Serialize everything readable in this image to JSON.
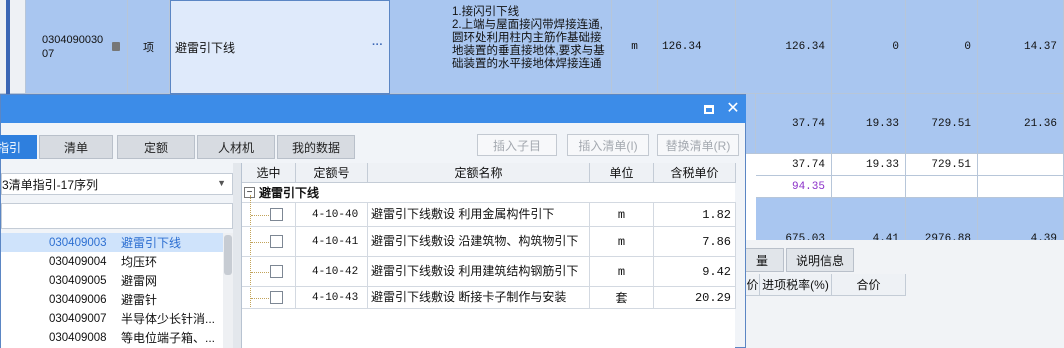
{
  "background": {
    "top_row": {
      "code": "0304090030\n07",
      "unit_type": "项",
      "name": "避雷引下线",
      "more": "···",
      "feature": "1.接闪引下线\n2.上端与屋面接闪带焊接连通,圆环处利用柱内主筋作基础接地装置的垂直接地体,要求与基础装置的水平接地体焊接连通",
      "unit": "m",
      "qty1": "126.34",
      "qty2": "126.34",
      "v3": "0",
      "v4": "0",
      "v5": "14.37"
    },
    "row2": [
      "37.74",
      "19.33",
      "729.51",
      "21.36"
    ],
    "row3": [
      "37.74",
      "19.33",
      "729.51"
    ],
    "row4": [
      "94.35"
    ],
    "row5": [
      "675.03",
      "4.41",
      "2976.88",
      "4.39"
    ]
  },
  "bottom_pane": {
    "tab_partial": "量",
    "tab_info": "说明信息",
    "headers": [
      "价",
      "进项税率(%)",
      "合价"
    ]
  },
  "dialog": {
    "tabs": [
      "指引",
      "清单",
      "定额",
      "人材机",
      "我的数据"
    ],
    "buttons": {
      "insert_child": "插入子目",
      "insert_list": "插入清单(I)",
      "replace_list": "替换清单(R)"
    },
    "library": "3清单指引-17序列",
    "search_value": "",
    "tree_items": [
      {
        "code": "030409003",
        "name": "避雷引下线"
      },
      {
        "code": "030409004",
        "name": "均压环"
      },
      {
        "code": "030409005",
        "name": "避雷网"
      },
      {
        "code": "030409006",
        "name": "避雷针"
      },
      {
        "code": "030409007",
        "name": "半导体少长针消..."
      },
      {
        "code": "030409008",
        "name": "等电位端子箱、..."
      }
    ],
    "grid": {
      "headers": [
        "选中",
        "定额号",
        "定额名称",
        "单位",
        "含税单价"
      ],
      "group": "避雷引下线",
      "rows": [
        {
          "code": "4-10-40",
          "name": "避雷引下线敷设 利用金属构件引下",
          "unit": "m",
          "price": "1.82"
        },
        {
          "code": "4-10-41",
          "name": "避雷引下线敷设 沿建筑物、构筑物引下",
          "unit": "m",
          "price": "7.86"
        },
        {
          "code": "4-10-42",
          "name": "避雷引下线敷设 利用建筑结构钢筋引下",
          "unit": "m",
          "price": "9.42"
        },
        {
          "code": "4-10-43",
          "name": "避雷引下线敷设 断接卡子制作与安装",
          "unit": "套",
          "price": "20.29"
        }
      ]
    }
  },
  "colors": {
    "row_selected": "#a9c6f0",
    "title_bar": "#3c8ce8",
    "tab_active": "#2e7fde",
    "link_text": "#2d6fd1",
    "purple_value": "#8b2fc9"
  }
}
